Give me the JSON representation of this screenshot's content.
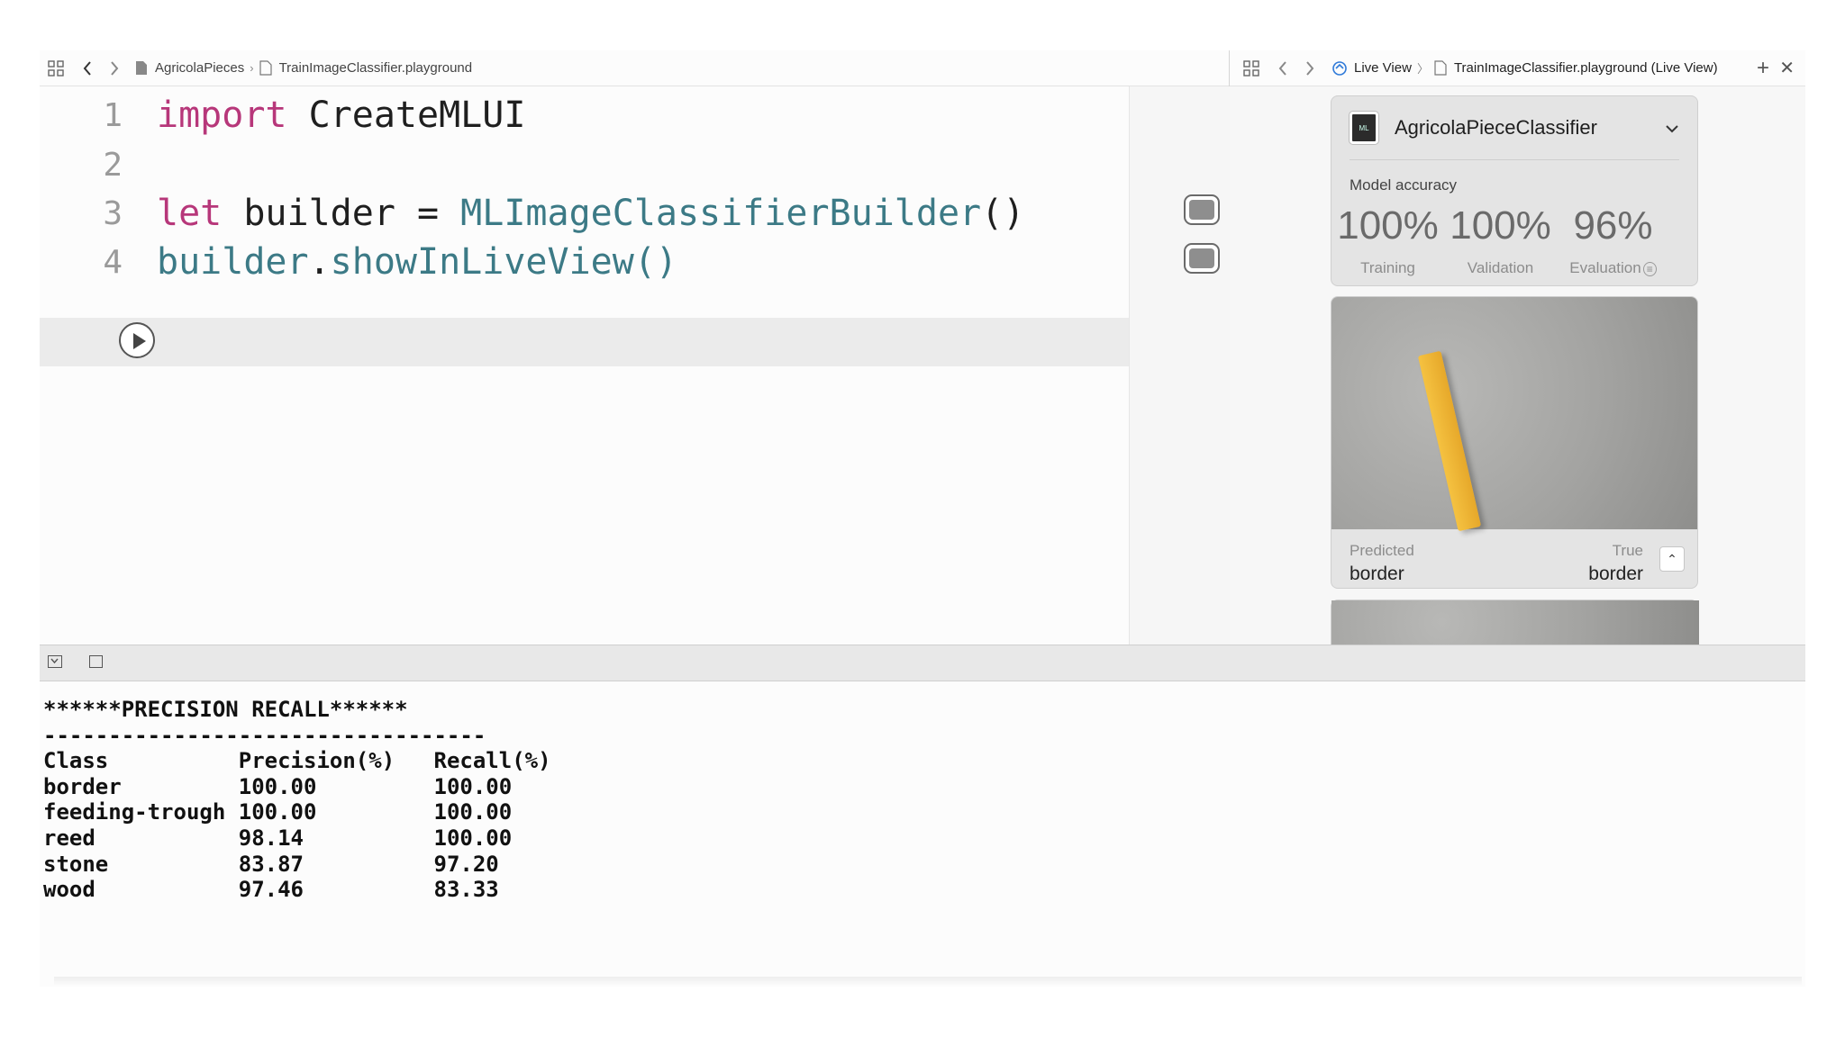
{
  "editor_bar": {
    "crumb_project": "AgricolaPieces",
    "crumb_file": "TrainImageClassifier.playground"
  },
  "live_bar": {
    "crumb_live": "Live View",
    "crumb_file": "TrainImageClassifier.playground (Live View)"
  },
  "code": {
    "lines": [
      {
        "num": "1",
        "kw": "import",
        "rest": " CreateMLUI"
      },
      {
        "num": "2"
      },
      {
        "num": "3",
        "kw": "let",
        "mid": " builder = ",
        "type": "MLImageClassifierBuilder",
        "end": "()"
      },
      {
        "num": "4",
        "obj": "builder",
        "dot": ".",
        "call": "showInLiveView()"
      }
    ]
  },
  "live_view": {
    "model_name": "AgricolaPieceClassifier",
    "accuracy_label": "Model accuracy",
    "accuracy": [
      {
        "value": "100%",
        "label": "Training"
      },
      {
        "value": "100%",
        "label": "Validation"
      },
      {
        "value": "96%",
        "label": "Evaluation"
      }
    ],
    "prediction": {
      "predicted_label": "Predicted",
      "predicted_value": "border",
      "true_label": "True",
      "true_value": "border"
    }
  },
  "console": {
    "title": "******PRECISION RECALL******",
    "separator": "----------------------------------",
    "headers": [
      "Class",
      "Precision(%)",
      "Recall(%)"
    ],
    "rows": [
      [
        "border",
        "100.00",
        "100.00"
      ],
      [
        "feeding-trough",
        "100.00",
        "100.00"
      ],
      [
        "reed",
        "98.14",
        "100.00"
      ],
      [
        "stone",
        "83.87",
        "97.20"
      ],
      [
        "wood",
        "97.46",
        "83.33"
      ]
    ]
  }
}
